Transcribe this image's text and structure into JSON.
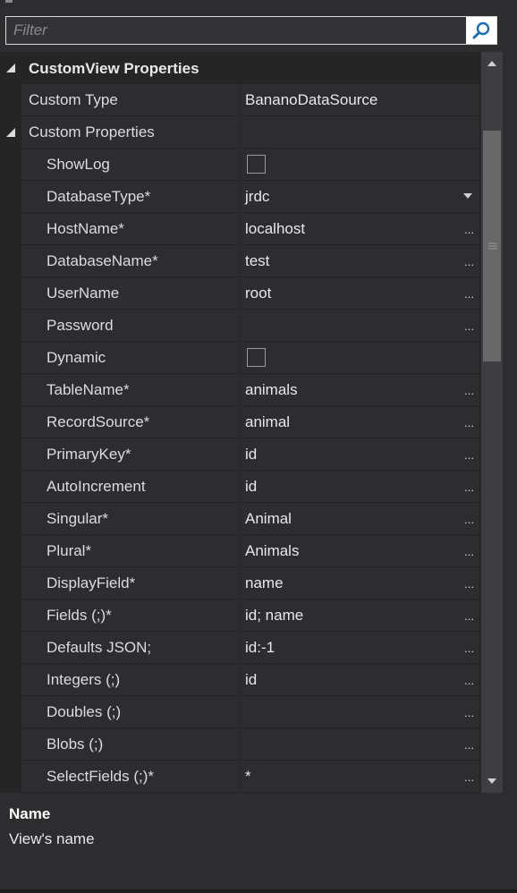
{
  "filter": {
    "placeholder": "Filter"
  },
  "category": {
    "label": "CustomView Properties"
  },
  "custom_type": {
    "name": "Custom Type",
    "value": "BananoDataSource"
  },
  "custom_properties": {
    "label": "Custom Properties"
  },
  "properties": [
    {
      "name": "ShowLog",
      "value": "",
      "editor": "checkbox"
    },
    {
      "name": "DatabaseType*",
      "value": "jrdc",
      "editor": "dropdown"
    },
    {
      "name": "HostName*",
      "value": "localhost",
      "editor": "ellipsis"
    },
    {
      "name": "DatabaseName*",
      "value": "test",
      "editor": "ellipsis"
    },
    {
      "name": "UserName",
      "value": "root",
      "editor": "ellipsis"
    },
    {
      "name": "Password",
      "value": "",
      "editor": "ellipsis"
    },
    {
      "name": "Dynamic",
      "value": "",
      "editor": "checkbox"
    },
    {
      "name": "TableName*",
      "value": "animals",
      "editor": "ellipsis"
    },
    {
      "name": "RecordSource*",
      "value": "animal",
      "editor": "ellipsis"
    },
    {
      "name": "PrimaryKey*",
      "value": "id",
      "editor": "ellipsis"
    },
    {
      "name": "AutoIncrement",
      "value": "id",
      "editor": "ellipsis"
    },
    {
      "name": "Singular*",
      "value": "Animal",
      "editor": "ellipsis"
    },
    {
      "name": "Plural*",
      "value": "Animals",
      "editor": "ellipsis"
    },
    {
      "name": "DisplayField*",
      "value": "name",
      "editor": "ellipsis"
    },
    {
      "name": "Fields (;)*",
      "value": "id; name",
      "editor": "ellipsis"
    },
    {
      "name": "Defaults JSON;",
      "value": "id:-1",
      "editor": "ellipsis"
    },
    {
      "name": "Integers (;)",
      "value": "id",
      "editor": "ellipsis"
    },
    {
      "name": "Doubles (;)",
      "value": "",
      "editor": "ellipsis"
    },
    {
      "name": "Blobs (;)",
      "value": "",
      "editor": "ellipsis"
    },
    {
      "name": "SelectFields (;)*",
      "value": "*",
      "editor": "ellipsis"
    }
  ],
  "ellipsis_glyph": "...",
  "description": {
    "title": "Name",
    "text": "View's name"
  },
  "colors": {
    "background": "#252526",
    "row": "#2d2d30",
    "scrollbar": "#3e3e42",
    "thumb": "#686868",
    "search_icon": "#1e6fb8"
  }
}
